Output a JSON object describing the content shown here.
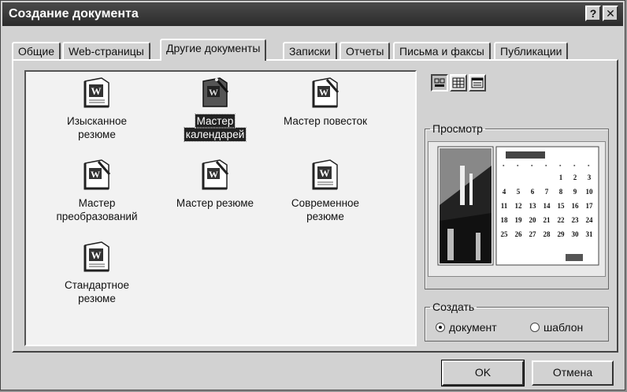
{
  "window": {
    "title": "Создание документа",
    "help_button": "?",
    "close_button": "✕"
  },
  "tabs": [
    {
      "label": "Общие",
      "active": false
    },
    {
      "label": "Web-страницы",
      "active": false
    },
    {
      "label": "Другие документы",
      "active": true
    },
    {
      "label": "Записки",
      "active": false
    },
    {
      "label": "Отчеты",
      "active": false
    },
    {
      "label": "Письма и факсы",
      "active": false
    },
    {
      "label": "Публикации",
      "active": false
    }
  ],
  "templates": [
    {
      "line1": "Изысканное",
      "line2": "резюме",
      "icon": "word-document-icon",
      "selected": false
    },
    {
      "line1": "Мастер",
      "line2": "календарей",
      "icon": "word-wizard-icon",
      "selected": true
    },
    {
      "line1": "Мастер повесток",
      "line2": "",
      "icon": "word-wizard-icon",
      "selected": false
    },
    {
      "line1": "Мастер",
      "line2": "преобразований",
      "icon": "word-wizard-icon",
      "selected": false
    },
    {
      "line1": "Мастер резюме",
      "line2": "",
      "icon": "word-wizard-icon",
      "selected": false
    },
    {
      "line1": "Современное",
      "line2": "резюме",
      "icon": "word-document-icon",
      "selected": false
    },
    {
      "line1": "Стандартное",
      "line2": "резюме",
      "icon": "word-document-icon",
      "selected": false
    }
  ],
  "view_buttons": [
    "large-icons-view-icon",
    "list-view-icon",
    "details-view-icon"
  ],
  "preview": {
    "label": "Просмотр",
    "calendar_rows": [
      [
        "1",
        "2",
        "3"
      ],
      [
        "4",
        "5",
        "6",
        "7",
        "8",
        "9",
        "10"
      ],
      [
        "11",
        "12",
        "13",
        "14",
        "15",
        "16",
        "17"
      ],
      [
        "18",
        "19",
        "20",
        "21",
        "22",
        "23",
        "24"
      ],
      [
        "25",
        "26",
        "27",
        "28",
        "29",
        "30",
        "31"
      ]
    ]
  },
  "create": {
    "label": "Создать",
    "options": [
      {
        "label": "документ",
        "checked": true
      },
      {
        "label": "шаблон",
        "checked": false
      }
    ]
  },
  "buttons": {
    "ok": "OK",
    "cancel": "Отмена"
  }
}
